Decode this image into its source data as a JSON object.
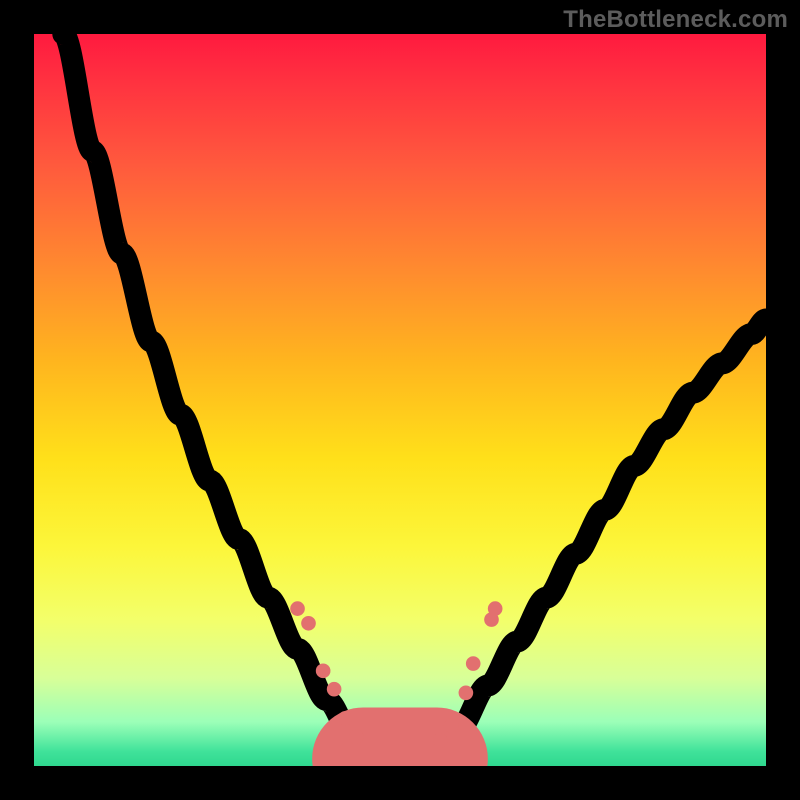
{
  "watermark": "TheBottleneck.com",
  "colors": {
    "frame": "#000000",
    "curve": "#000000",
    "marker": "#e2706f",
    "gradient_top": "#ff1a3f",
    "gradient_bottom": "#2fd88f"
  },
  "chart_data": {
    "type": "line",
    "title": "",
    "xlabel": "",
    "ylabel": "",
    "xlim": [
      0,
      100
    ],
    "ylim": [
      0,
      100
    ],
    "grid": false,
    "legend": false,
    "series": [
      {
        "name": "left-curve",
        "x": [
          4,
          8,
          12,
          16,
          20,
          24,
          28,
          32,
          36,
          40,
          44,
          46
        ],
        "y": [
          100,
          84,
          70,
          58,
          48,
          39,
          31,
          23,
          16,
          9,
          3,
          1
        ]
      },
      {
        "name": "right-curve",
        "x": [
          54,
          58,
          62,
          66,
          70,
          74,
          78,
          82,
          86,
          90,
          94,
          98,
          100
        ],
        "y": [
          1,
          5,
          11,
          17,
          23,
          29,
          35,
          41,
          46,
          51,
          55,
          59,
          61
        ]
      },
      {
        "name": "flat-min",
        "x": [
          45,
          55
        ],
        "y": [
          1,
          1
        ]
      }
    ],
    "markers": [
      {
        "x": 36.0,
        "y": 21.5
      },
      {
        "x": 37.5,
        "y": 19.5
      },
      {
        "x": 39.5,
        "y": 13.0
      },
      {
        "x": 41.0,
        "y": 10.5
      },
      {
        "x": 42.5,
        "y": 6.5
      },
      {
        "x": 44.0,
        "y": 4.0
      },
      {
        "x": 55.5,
        "y": 3.5
      },
      {
        "x": 57.0,
        "y": 5.5
      },
      {
        "x": 59.0,
        "y": 10.0
      },
      {
        "x": 60.0,
        "y": 14.0
      },
      {
        "x": 62.5,
        "y": 20.0
      },
      {
        "x": 63.0,
        "y": 21.5
      }
    ]
  }
}
